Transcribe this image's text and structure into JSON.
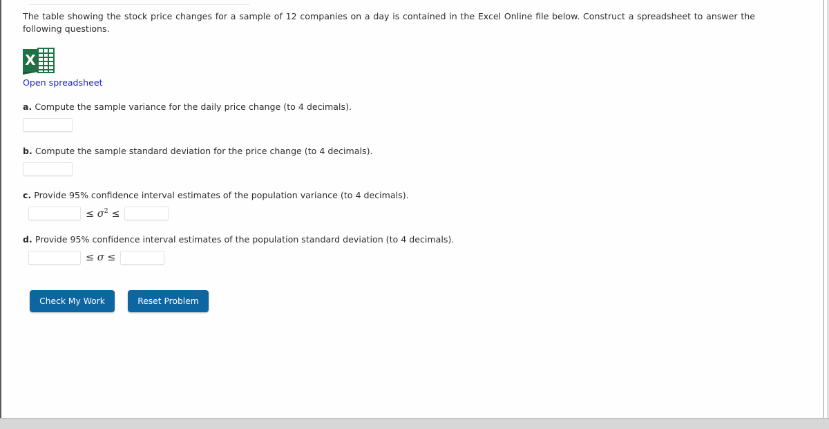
{
  "problem": {
    "intro": "The table showing the stock price changes for a sample of 12 companies on a day is contained in the Excel Online file below. Construct a spreadsheet to answer the following questions.",
    "spreadsheet_link": "Open spreadsheet",
    "excel_icon_letter": "X"
  },
  "questions": [
    {
      "label": "a.",
      "text": "Compute the sample variance for the daily price change (to 4 decimals).",
      "answer_value": "",
      "type": "single"
    },
    {
      "label": "b.",
      "text": "Compute the sample standard deviation for the price change (to 4 decimals).",
      "answer_value": "",
      "type": "single"
    },
    {
      "label": "c.",
      "text": "Provide 95% confidence interval estimates of the population variance (to 4 decimals).",
      "lower_value": "",
      "upper_value": "",
      "relation_left": "≤",
      "relation_symbol": "σ",
      "relation_exponent": "2",
      "relation_right": "≤",
      "type": "interval"
    },
    {
      "label": "d.",
      "text": "Provide 95% confidence interval estimates of the population standard deviation (to 4 decimals).",
      "lower_value": "",
      "upper_value": "",
      "relation_left": "≤",
      "relation_symbol": "σ",
      "relation_exponent": "",
      "relation_right": "≤",
      "type": "interval"
    }
  ],
  "buttons": {
    "check": "Check My Work",
    "reset": "Reset Problem"
  },
  "colors": {
    "button_blue": "#0e66a0",
    "link_blue": "#2222dd",
    "excel_green": "#1e7145"
  }
}
